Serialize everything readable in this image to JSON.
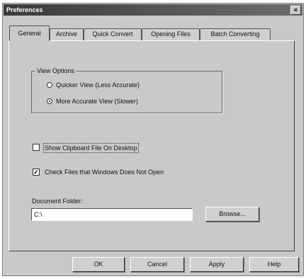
{
  "window": {
    "title": "Preferences",
    "close_glyph": "×"
  },
  "tabs": [
    {
      "label": "General",
      "active": true
    },
    {
      "label": "Archive"
    },
    {
      "label": "Quick Convert"
    },
    {
      "label": "Opening Files"
    },
    {
      "label": "Batch Converting"
    }
  ],
  "view_options": {
    "title": "View Options",
    "options": [
      {
        "label": "Quicker View (Less Accurate)",
        "selected": false
      },
      {
        "label": "More Accurate View (Slower)",
        "selected": true
      }
    ]
  },
  "checkboxes": [
    {
      "label": "Show Clipboard File On Desktop",
      "checked": false
    },
    {
      "label": "Check Files that Windows Does Not Open",
      "checked": true
    }
  ],
  "document_folder": {
    "label": "Document Folder:",
    "value": "C:\\",
    "browse_label": "Browse..."
  },
  "footer": {
    "ok": "OK",
    "cancel": "Cancel",
    "apply": "Apply",
    "help": "Help"
  }
}
